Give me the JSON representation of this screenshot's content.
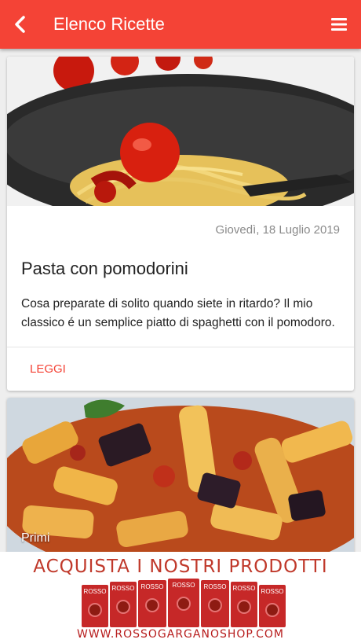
{
  "appbar": {
    "title": "Elenco Ricette",
    "back_icon": "chevron-left-icon",
    "menu_icon": "hamburger-menu-icon",
    "color": "#f44336"
  },
  "recipes": [
    {
      "date": "Giovedì, 18 Luglio 2019",
      "title": "Pasta con pomodorini",
      "excerpt": "Cosa preparate di solito quando siete in ritardo? Il mio classico é un semplice piatto di spaghetti con il pomodoro.",
      "action": "LEGGI"
    },
    {
      "category": "Primi"
    }
  ],
  "ad": {
    "headline": "ACQUISTA I NOSTRI PRODOTTI",
    "url": "WWW.ROSSOGARGANOSHOP.COM",
    "brand": "ROSSO"
  }
}
